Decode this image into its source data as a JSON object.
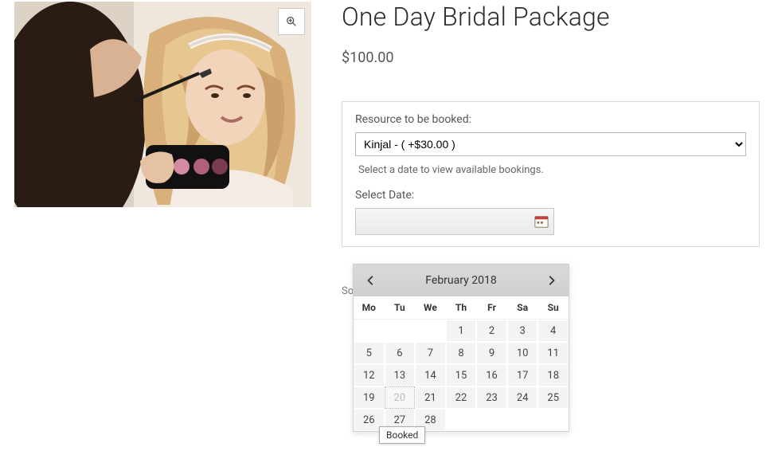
{
  "product": {
    "title": "One Day Bridal Package",
    "price": "$100.00"
  },
  "booking": {
    "resource_label": "Resource to be booked:",
    "resource_selected": "Kinjal - ( +$30.00 )",
    "hint": "Select a date to view available bookings.",
    "date_label": "Select Date:",
    "date_value": ""
  },
  "sorry_text": "So",
  "datepicker": {
    "month_title": "February 2018",
    "dow": [
      "Mo",
      "Tu",
      "We",
      "Th",
      "Fr",
      "Sa",
      "Su"
    ],
    "lead_blank": 3,
    "days": [
      {
        "n": 1
      },
      {
        "n": 2
      },
      {
        "n": 3
      },
      {
        "n": 4
      },
      {
        "n": 5
      },
      {
        "n": 6
      },
      {
        "n": 7
      },
      {
        "n": 8
      },
      {
        "n": 9
      },
      {
        "n": 10
      },
      {
        "n": 11
      },
      {
        "n": 12
      },
      {
        "n": 13
      },
      {
        "n": 14
      },
      {
        "n": 15
      },
      {
        "n": 16
      },
      {
        "n": 17
      },
      {
        "n": 18
      },
      {
        "n": 19
      },
      {
        "n": 20,
        "booked": true
      },
      {
        "n": 21
      },
      {
        "n": 22
      },
      {
        "n": 23
      },
      {
        "n": 24
      },
      {
        "n": 25
      },
      {
        "n": 26
      },
      {
        "n": 27
      },
      {
        "n": 28
      }
    ],
    "tooltip": "Booked"
  },
  "icons": {
    "zoom": "zoom-icon",
    "prev": "chevron-left-icon",
    "next": "chevron-right-icon",
    "calendar": "calendar-icon"
  }
}
